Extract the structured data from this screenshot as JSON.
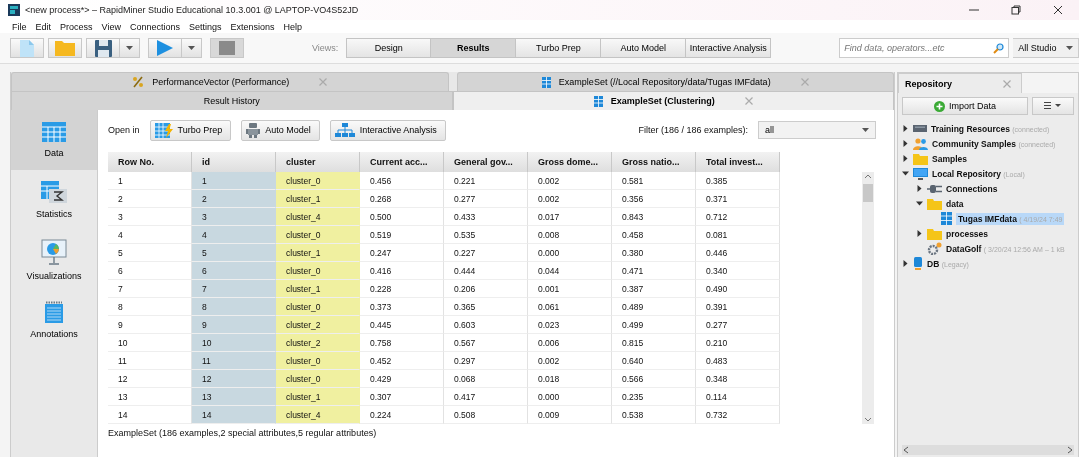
{
  "window": {
    "title": "<new process*> – RapidMiner Studio Educational 10.3.001 @ LAPTOP-VO4S52JD"
  },
  "menu": [
    "File",
    "Edit",
    "Process",
    "View",
    "Connections",
    "Settings",
    "Extensions",
    "Help"
  ],
  "views": {
    "label": "Views:",
    "items": [
      {
        "label": "Design",
        "selected": false
      },
      {
        "label": "Results",
        "selected": true
      },
      {
        "label": "Turbo Prep",
        "selected": false
      },
      {
        "label": "Auto Model",
        "selected": false
      },
      {
        "label": "Interactive Analysis",
        "selected": false
      }
    ]
  },
  "search": {
    "placeholder": "Find data, operators...etc",
    "scope": "All Studio"
  },
  "result_tabs": [
    {
      "tabs": [
        {
          "label": "PerformanceVector (Performance)",
          "kind": "performance",
          "selected": false,
          "closable": true
        },
        {
          "label": "ExampleSet (//Local Repository/data/Tugas IMFdata)",
          "kind": "exampleset",
          "selected": false,
          "closable": true
        }
      ]
    },
    {
      "tabs": [
        {
          "label": "Result History",
          "kind": "history",
          "selected": false,
          "closable": false
        },
        {
          "label": "ExampleSet (Clustering)",
          "kind": "exampleset",
          "selected": true,
          "closable": true
        }
      ]
    }
  ],
  "side_nav": [
    {
      "label": "Data",
      "kind": "data",
      "selected": true
    },
    {
      "label": "Statistics",
      "kind": "statistics",
      "selected": false
    },
    {
      "label": "Visualizations",
      "kind": "visualizations",
      "selected": false
    },
    {
      "label": "Annotations",
      "kind": "annotations",
      "selected": false
    }
  ],
  "open_in": {
    "label": "Open in",
    "buttons": [
      {
        "label": "Turbo Prep",
        "kind": "turbo"
      },
      {
        "label": "Auto Model",
        "kind": "robot"
      },
      {
        "label": "Interactive Analysis",
        "kind": "hierarchy"
      }
    ]
  },
  "filter": {
    "label": "Filter (186 / 186 examples):",
    "value": "all"
  },
  "table": {
    "columns": [
      {
        "label": "Row No.",
        "kind": "row"
      },
      {
        "label": "id",
        "kind": "id"
      },
      {
        "label": "cluster",
        "kind": "cluster"
      },
      {
        "label": "Current acc...",
        "kind": "regular"
      },
      {
        "label": "General gov...",
        "kind": "regular"
      },
      {
        "label": "Gross dome...",
        "kind": "regular"
      },
      {
        "label": "Gross natio...",
        "kind": "regular"
      },
      {
        "label": "Total invest...",
        "kind": "regular"
      }
    ],
    "rows": [
      [
        "1",
        "1",
        "cluster_0",
        "0.456",
        "0.221",
        "0.002",
        "0.581",
        "0.385"
      ],
      [
        "2",
        "2",
        "cluster_1",
        "0.268",
        "0.277",
        "0.002",
        "0.356",
        "0.371"
      ],
      [
        "3",
        "3",
        "cluster_4",
        "0.500",
        "0.433",
        "0.017",
        "0.843",
        "0.712"
      ],
      [
        "4",
        "4",
        "cluster_0",
        "0.519",
        "0.535",
        "0.008",
        "0.458",
        "0.081"
      ],
      [
        "5",
        "5",
        "cluster_1",
        "0.247",
        "0.227",
        "0.000",
        "0.380",
        "0.446"
      ],
      [
        "6",
        "6",
        "cluster_0",
        "0.416",
        "0.444",
        "0.044",
        "0.471",
        "0.340"
      ],
      [
        "7",
        "7",
        "cluster_1",
        "0.228",
        "0.206",
        "0.001",
        "0.387",
        "0.490"
      ],
      [
        "8",
        "8",
        "cluster_0",
        "0.373",
        "0.365",
        "0.061",
        "0.489",
        "0.391"
      ],
      [
        "9",
        "9",
        "cluster_2",
        "0.445",
        "0.603",
        "0.023",
        "0.499",
        "0.277"
      ],
      [
        "10",
        "10",
        "cluster_2",
        "0.758",
        "0.567",
        "0.006",
        "0.815",
        "0.210"
      ],
      [
        "11",
        "11",
        "cluster_0",
        "0.452",
        "0.297",
        "0.002",
        "0.640",
        "0.483"
      ],
      [
        "12",
        "12",
        "cluster_0",
        "0.429",
        "0.068",
        "0.018",
        "0.566",
        "0.348"
      ],
      [
        "13",
        "13",
        "cluster_1",
        "0.307",
        "0.417",
        "0.000",
        "0.235",
        "0.114"
      ],
      [
        "14",
        "14",
        "cluster_4",
        "0.224",
        "0.508",
        "0.009",
        "0.538",
        "0.732"
      ]
    ]
  },
  "status": "ExampleSet (186 examples,2 special attributes,5 regular attributes)",
  "repository": {
    "title": "Repository",
    "import_button": "Import Data",
    "tree": [
      {
        "label": "Training Resources",
        "note": "(connected)",
        "kind": "training",
        "selected": false,
        "expanded": false
      },
      {
        "label": "Community Samples",
        "note": "(connected)",
        "kind": "people",
        "selected": false,
        "expanded": false
      },
      {
        "label": "Samples",
        "kind": "folder",
        "selected": false,
        "expanded": false
      },
      {
        "label": "Local Repository",
        "note": "(Local)",
        "kind": "monitor",
        "selected": false,
        "expanded": true,
        "children": [
          {
            "label": "Connections",
            "kind": "plug",
            "selected": false,
            "expanded": false
          },
          {
            "label": "data",
            "kind": "folder",
            "selected": false,
            "expanded": true,
            "children": [
              {
                "label": "Tugas IMFdata",
                "note": "( 4/19/24 7:49",
                "kind": "dataset",
                "selected": true
              }
            ]
          },
          {
            "label": "processes",
            "kind": "folder",
            "selected": false,
            "expanded": false
          },
          {
            "label": "DataGolf",
            "note": "( 3/20/24 12:56 AM – 1 kB",
            "kind": "process",
            "selected": false
          }
        ]
      },
      {
        "label": "DB",
        "note": "(Legacy)",
        "kind": "db",
        "selected": false,
        "expanded": false
      }
    ]
  }
}
